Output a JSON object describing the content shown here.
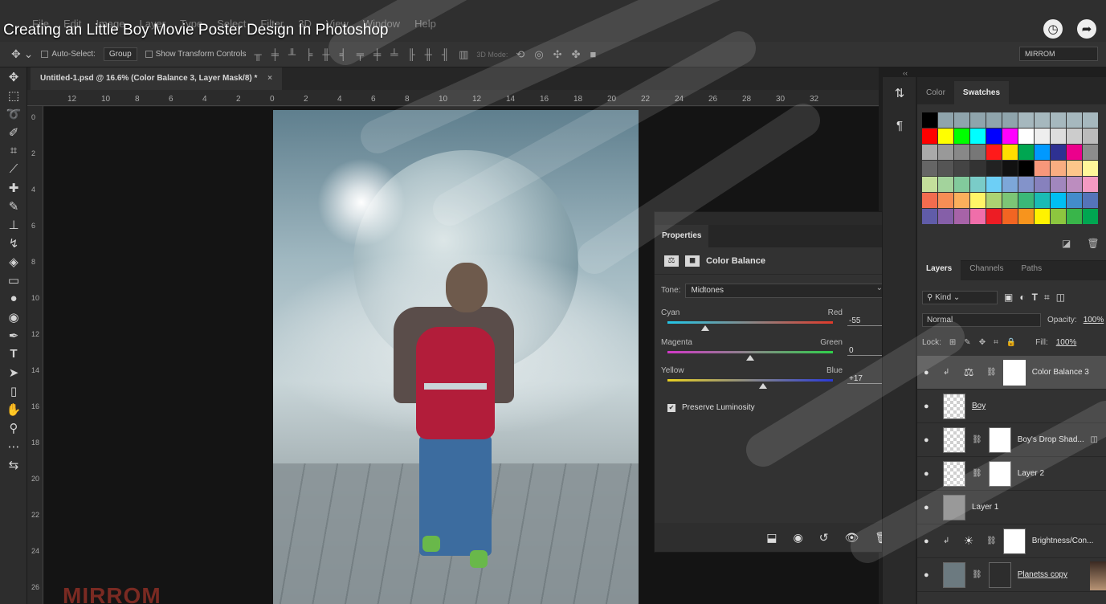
{
  "video_title": "Creating an Little Boy Movie Poster Design In Photoshop",
  "menu": [
    "File",
    "Edit",
    "Image",
    "Layer",
    "Type",
    "Select",
    "Filter",
    "3D",
    "View",
    "Window",
    "Help"
  ],
  "top_right_icons": [
    "clock-icon",
    "share-icon"
  ],
  "options_bar": {
    "auto_select_label": "Auto-Select:",
    "auto_select_value": "Group",
    "show_transform_label": "Show Transform Controls",
    "mode_3d_label": "3D Mode:",
    "workspace": "MIRROM"
  },
  "document_tab": {
    "title": "Untitled-1.psd @ 16.6% (Color Balance 3, Layer Mask/8) *",
    "close": "×"
  },
  "ruler_h_ticks": [
    "12",
    "10",
    "8",
    "6",
    "4",
    "2",
    "0",
    "2",
    "4",
    "6",
    "8",
    "10",
    "12",
    "14",
    "16",
    "18",
    "20",
    "22",
    "24",
    "26",
    "28",
    "30",
    "32"
  ],
  "ruler_v_ticks": [
    "0",
    "2",
    "4",
    "6",
    "8",
    "10",
    "12",
    "14",
    "16",
    "18",
    "20",
    "22",
    "24",
    "26"
  ],
  "canvas_logo": "MIRROM",
  "properties": {
    "tab": "Properties",
    "adjustment": "Color Balance",
    "tone_label": "Tone:",
    "tone_value": "Midtones",
    "sliders": [
      {
        "left": "Cyan",
        "right": "Red",
        "value": "-55",
        "fraction": 0.23
      },
      {
        "left": "Magenta",
        "right": "Green",
        "value": "0",
        "fraction": 0.5
      },
      {
        "left": "Yellow",
        "right": "Blue",
        "value": "+17",
        "fraction": 0.58
      }
    ],
    "preserve_luminosity": "Preserve Luminosity"
  },
  "color_panel": {
    "tabs": [
      "Color",
      "Swatches"
    ],
    "active_tab": "Swatches"
  },
  "layers_panel": {
    "tabs": [
      "Layers",
      "Channels",
      "Paths"
    ],
    "filter_kind": "Kind",
    "blend_mode": "Normal",
    "opacity_label": "Opacity:",
    "opacity_value": "100%",
    "lock_label": "Lock:",
    "fill_label": "Fill:",
    "fill_value": "100%",
    "layers": [
      {
        "name": "Color Balance 3"
      },
      {
        "name": "Boy"
      },
      {
        "name": "Boy's Drop Shad..."
      },
      {
        "name": "Layer 2"
      },
      {
        "name": "Layer 1"
      },
      {
        "name": "Brightness/Con..."
      },
      {
        "name": "Planetss copy"
      }
    ]
  }
}
